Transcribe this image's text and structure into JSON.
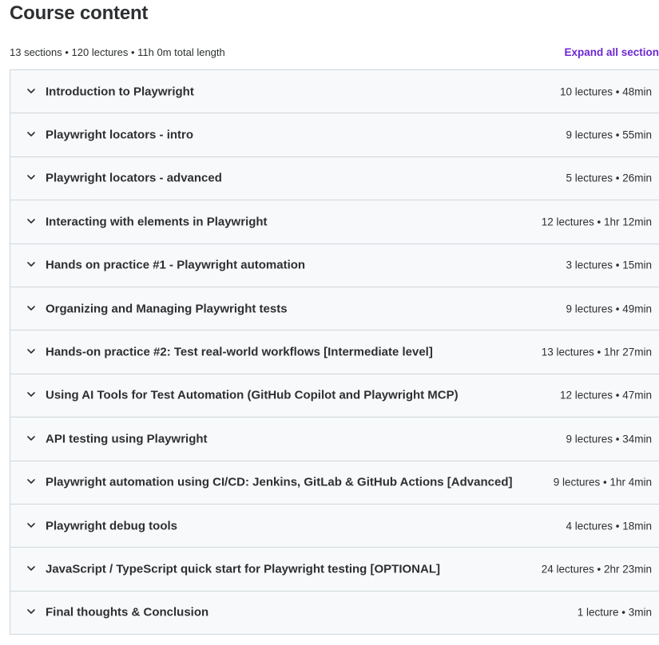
{
  "header": {
    "title": "Course content",
    "summary": "13 sections • 120 lectures • 11h 0m total length",
    "expand_all_label": "Expand all section"
  },
  "colors": {
    "accent": "#6d28d2",
    "section_bg": "#f7f9fa",
    "border": "#d1d7dc",
    "text": "#2d2f31"
  },
  "sections": [
    {
      "title": "Introduction to Playwright",
      "meta": "10 lectures • 48min",
      "icon": "chevron-down-icon"
    },
    {
      "title": "Playwright locators - intro",
      "meta": "9 lectures • 55min",
      "icon": "chevron-down-icon"
    },
    {
      "title": "Playwright locators - advanced",
      "meta": "5 lectures • 26min",
      "icon": "chevron-down-icon"
    },
    {
      "title": "Interacting with elements in Playwright",
      "meta": "12 lectures • 1hr 12min",
      "icon": "chevron-down-icon"
    },
    {
      "title": "Hands on practice #1 - Playwright automation",
      "meta": "3 lectures • 15min",
      "icon": "chevron-down-icon"
    },
    {
      "title": "Organizing and Managing Playwright tests",
      "meta": "9 lectures • 49min",
      "icon": "chevron-down-icon"
    },
    {
      "title": "Hands-on practice #2: Test real-world workflows [Intermediate level]",
      "meta": "13 lectures • 1hr 27min",
      "icon": "chevron-down-icon"
    },
    {
      "title": "Using AI Tools for Test Automation (GitHub Copilot and Playwright MCP)",
      "meta": "12 lectures • 47min",
      "icon": "chevron-down-icon"
    },
    {
      "title": "API testing using Playwright",
      "meta": "9 lectures • 34min",
      "icon": "chevron-down-icon"
    },
    {
      "title": "Playwright automation using CI/CD: Jenkins, GitLab & GitHub Actions [Advanced]",
      "meta": "9 lectures • 1hr 4min",
      "icon": "chevron-down-icon"
    },
    {
      "title": "Playwright debug tools",
      "meta": "4 lectures • 18min",
      "icon": "chevron-down-icon"
    },
    {
      "title": "JavaScript / TypeScript quick start for Playwright testing [OPTIONAL]",
      "meta": "24 lectures • 2hr 23min",
      "icon": "chevron-down-icon"
    },
    {
      "title": "Final thoughts & Conclusion",
      "meta": "1 lecture • 3min",
      "icon": "chevron-down-icon"
    }
  ]
}
